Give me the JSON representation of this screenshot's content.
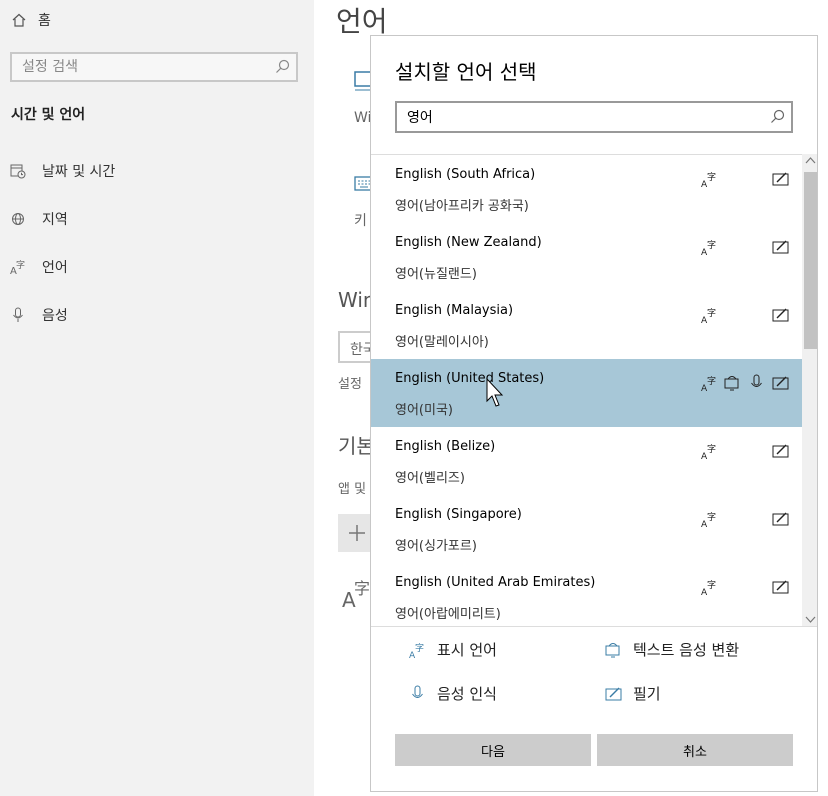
{
  "sidebar": {
    "home_label": "홈",
    "search_placeholder": "설정 검색",
    "section_title": "시간 및 언어",
    "items": [
      {
        "label": "날짜 및 시간",
        "icon": "calendar-clock-icon"
      },
      {
        "label": "지역",
        "icon": "globe-icon"
      },
      {
        "label": "언어",
        "icon": "language-icon"
      },
      {
        "label": "음성",
        "icon": "microphone-icon"
      }
    ]
  },
  "background": {
    "page_title": "언어",
    "frag_windows": "Wi",
    "frag_keyboard": "키",
    "frag_heading": "Win",
    "frag_dropdown": "한국",
    "frag_settings": "설정",
    "frag_basic": "기본",
    "frag_app": "앱 및"
  },
  "dialog": {
    "title": "설치할 언어 선택",
    "search_value": "영어",
    "languages": [
      {
        "english": "English (South Africa)",
        "korean": "영어(남아프리카 공화국)",
        "features": [
          "display-language",
          "handwriting"
        ],
        "selected": false
      },
      {
        "english": "English (New Zealand)",
        "korean": "영어(뉴질랜드)",
        "features": [
          "display-language",
          "handwriting"
        ],
        "selected": false
      },
      {
        "english": "English (Malaysia)",
        "korean": "영어(말레이시아)",
        "features": [
          "display-language",
          "handwriting"
        ],
        "selected": false
      },
      {
        "english": "English (United States)",
        "korean": "영어(미국)",
        "features": [
          "display-language",
          "text-to-speech",
          "speech-recognition",
          "handwriting"
        ],
        "selected": true
      },
      {
        "english": "English (Belize)",
        "korean": "영어(벨리즈)",
        "features": [
          "display-language",
          "handwriting"
        ],
        "selected": false
      },
      {
        "english": "English (Singapore)",
        "korean": "영어(싱가포르)",
        "features": [
          "display-language",
          "handwriting"
        ],
        "selected": false
      },
      {
        "english": "English (United Arab Emirates)",
        "korean": "영어(아랍에미리트)",
        "features": [
          "display-language",
          "handwriting"
        ],
        "selected": false
      }
    ],
    "legend": {
      "display_language": "표시 언어",
      "text_to_speech": "텍스트 음성 변환",
      "speech_recognition": "음성 인식",
      "handwriting": "필기"
    },
    "next_label": "다음",
    "cancel_label": "취소"
  },
  "colors": {
    "selected_row": "#a7c7d7",
    "sidebar_bg": "#f2f2f2",
    "button_bg": "#cccccc",
    "icon_accent": "#3a7ca5"
  }
}
